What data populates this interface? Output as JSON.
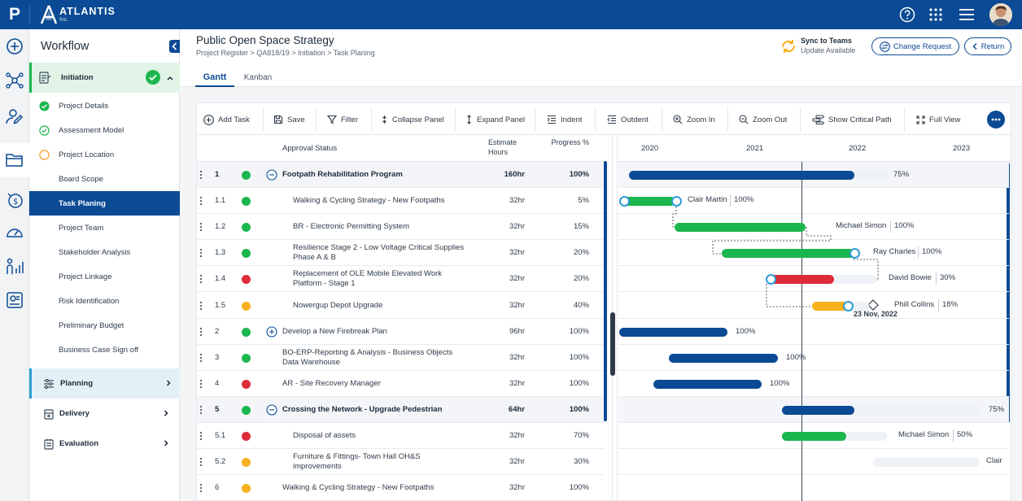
{
  "brand": {
    "logo_letter": "P",
    "name": "ATLANTIS",
    "sub": "Inc."
  },
  "sidebar": {
    "title": "Workflow",
    "sections": [
      {
        "label": "Initiation",
        "state": "complete"
      },
      {
        "label": "Planning"
      },
      {
        "label": "Delivery"
      },
      {
        "label": "Evaluation"
      }
    ],
    "items": [
      {
        "label": "Project Details",
        "status": "done-filled"
      },
      {
        "label": "Assessment Model",
        "status": "done-outline"
      },
      {
        "label": "Project Location",
        "status": "in-progress"
      },
      {
        "label": "Board Scope",
        "status": "none"
      },
      {
        "label": "Task Planing",
        "status": "active"
      },
      {
        "label": "Project Team",
        "status": "none"
      },
      {
        "label": "Stakeholder Analysis",
        "status": "none"
      },
      {
        "label": "Project Linkage",
        "status": "none"
      },
      {
        "label": "Risk Identification",
        "status": "none"
      },
      {
        "label": "Preliminary Budget",
        "status": "none"
      },
      {
        "label": "Business Case Sign off",
        "status": "none"
      }
    ]
  },
  "header": {
    "title": "Public Open Space Strategy",
    "breadcrumb": "Project Register > QA818/19 > Initiation > Task Planing",
    "sync_title": "Sync to Teams",
    "sync_sub": "Update Available",
    "change_request": "Change Request",
    "return": "Return",
    "tabs": [
      "Gantt",
      "Kanban"
    ],
    "active_tab": "Gantt"
  },
  "toolbar": {
    "add_task": "Add Task",
    "save": "Save",
    "filter": "Filter",
    "collapse": "Collapse Panel",
    "expand": "Expand Panel",
    "indent": "Indent",
    "outdent": "Outdent",
    "zoom_in": "Zoom In",
    "zoom_out": "Zoom Out",
    "critical_path": "Show Critical Path",
    "full_view": "Full View"
  },
  "grid": {
    "col_status": "Approval Status",
    "col_estimate": "Estimate Hours",
    "col_progress": "Progress %"
  },
  "colors": {
    "green": "#1cb64e",
    "red": "#dd2b3a",
    "amber": "#f7b01e",
    "navy": "#0b4a94",
    "primary": "#0b4a94"
  },
  "years": [
    "2020",
    "2021",
    "2022",
    "2023"
  ],
  "today_marker": "23 Nov, 2022",
  "tasks": [
    {
      "id": "1",
      "status": "green",
      "name": "Footpath Rehabilitation Program",
      "hours": "160hr",
      "progress": "100%",
      "summary": true,
      "toggle": "minus",
      "bar": {
        "color": "navy",
        "progress": 1.0
      },
      "bar_label": "75%"
    },
    {
      "id": "1.1",
      "status": "green",
      "name": "Walking & Cycling Strategy - New Footpaths",
      "hours": "32hr",
      "progress": "5%",
      "indent": 1,
      "bar": {
        "color": "green",
        "progress": 1.0
      },
      "assignee": "Clair Martin",
      "assignee_pct": "100%"
    },
    {
      "id": "1.2",
      "status": "green",
      "name": "BR - Electronic Permitting System",
      "hours": "32hr",
      "progress": "15%",
      "indent": 1,
      "bar": {
        "color": "green",
        "progress": 1.0
      },
      "assignee": "Michael Simon",
      "assignee_pct": "100%"
    },
    {
      "id": "1.3",
      "status": "green",
      "name": "Resilience Stage 2 - Low Voltage Critical Supplies Phase A & B",
      "hours": "32hr",
      "progress": "20%",
      "indent": 1,
      "bar": {
        "color": "green",
        "progress": 1.0
      },
      "assignee": "Ray Charles",
      "assignee_pct": "100%"
    },
    {
      "id": "1.4",
      "status": "red",
      "name": "Replacement of OLE Mobile Elevated Work Platform - Stage 1",
      "hours": "32hr",
      "progress": "20%",
      "indent": 1,
      "bar": {
        "color": "red",
        "progress": 0.6
      },
      "assignee": "David Bowie",
      "assignee_pct": "30%"
    },
    {
      "id": "1.5",
      "status": "amber",
      "name": "Nowergup Depot Upgrade",
      "hours": "32hr",
      "progress": "40%",
      "indent": 1,
      "bar": {
        "color": "amber",
        "progress": 0.8
      },
      "assignee": "Phill Collins",
      "assignee_pct": "18%"
    },
    {
      "id": "2",
      "status": "green",
      "name": "Develop a New Firebreak Plan",
      "hours": "96hr",
      "progress": "100%",
      "toggle": "plus",
      "bar": {
        "color": "navy",
        "progress": 1.0
      },
      "bar_label": "100%"
    },
    {
      "id": "3",
      "status": "green",
      "name": "BO-ERP-Reporting & Analysis - Business Objects Data Warehouse",
      "hours": "32hr",
      "progress": "100%",
      "bar": {
        "color": "navy",
        "progress": 1.0
      },
      "bar_label": "100%"
    },
    {
      "id": "4",
      "status": "red",
      "name": "AR - Site Recovery Manager",
      "hours": "32hr",
      "progress": "100%",
      "bar": {
        "color": "navy",
        "progress": 1.0
      },
      "bar_label": "100%"
    },
    {
      "id": "5",
      "status": "green",
      "name": "Crossing the Network - Upgrade Pedestrian",
      "hours": "64hr",
      "progress": "100%",
      "summary": true,
      "toggle": "minus",
      "bar": {
        "color": "navy",
        "progress": 0.37
      },
      "bar_label": "75%"
    },
    {
      "id": "5.1",
      "status": "red",
      "name": "Disposal of assets",
      "hours": "32hr",
      "progress": "70%",
      "indent": 1,
      "bar": {
        "color": "green",
        "progress": 0.6
      },
      "assignee": "Michael Simon",
      "assignee_pct": "50%"
    },
    {
      "id": "5.2",
      "status": "amber",
      "name": "Furniture & Fittings- Town Hall OH&S improvements",
      "hours": "32hr",
      "progress": "30%",
      "indent": 1,
      "bar": {
        "color": "none",
        "progress": 0
      },
      "assignee": "Clair"
    },
    {
      "id": "6",
      "status": "amber",
      "name": "Walking & Cycling Strategy - New Footpaths",
      "hours": "32hr",
      "progress": "100%"
    }
  ]
}
